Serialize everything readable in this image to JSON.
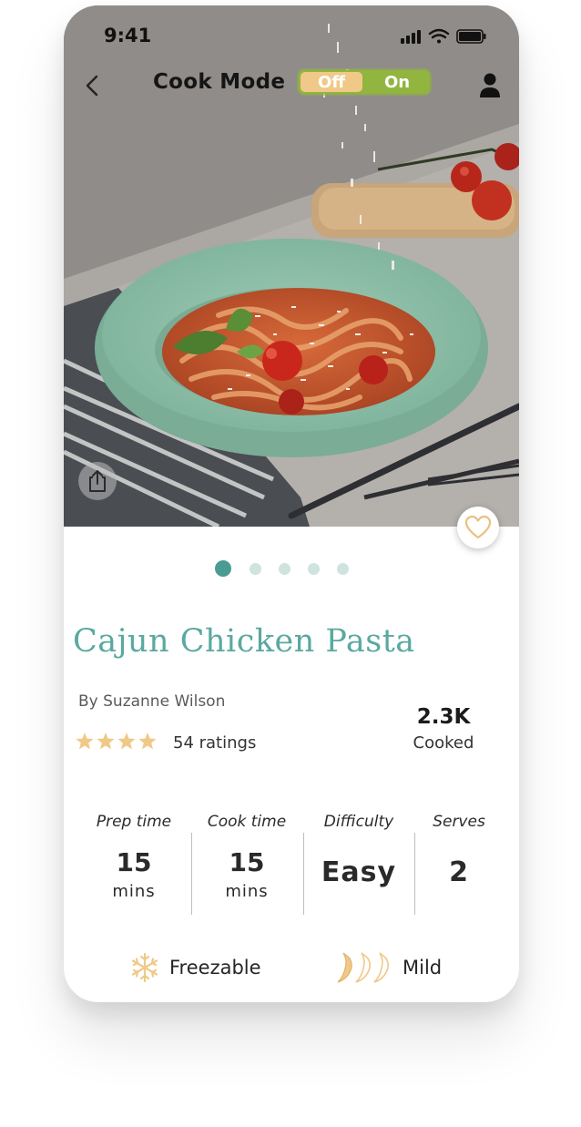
{
  "status_bar": {
    "time": "9:41"
  },
  "nav": {
    "title": "Cook Mode",
    "toggle": {
      "off_label": "Off",
      "on_label": "On",
      "selected": "On"
    }
  },
  "icons": {
    "back": "chevron-left-icon",
    "profile": "user-icon",
    "share": "share-icon",
    "favorite": "heart-icon",
    "freezable": "snowflake-icon",
    "spice": "chili-pepper-icon"
  },
  "carousel": {
    "count": 5,
    "active_index": 0
  },
  "recipe": {
    "title": "Cajun Chicken Pasta",
    "author": "By Suzanne Wilson",
    "rating_stars": 4,
    "ratings_text": "54 ratings",
    "cooked_count": "2.3K",
    "cooked_label": "Cooked"
  },
  "stats": [
    {
      "label": "Prep time",
      "value": "15",
      "unit": "mins"
    },
    {
      "label": "Cook time",
      "value": "15",
      "unit": "mins"
    },
    {
      "label": "Difficulty",
      "value": "Easy",
      "unit": ""
    },
    {
      "label": "Serves",
      "value": "2",
      "unit": ""
    }
  ],
  "features": {
    "freezable": "Freezable",
    "spice_level": "Mild",
    "spice_level_value": 1,
    "spice_level_max": 3
  },
  "colors": {
    "accent_teal": "#5aa9a0",
    "toggle_green": "#91b53f",
    "toggle_off": "#f0c988",
    "gold": "#f0c988"
  }
}
